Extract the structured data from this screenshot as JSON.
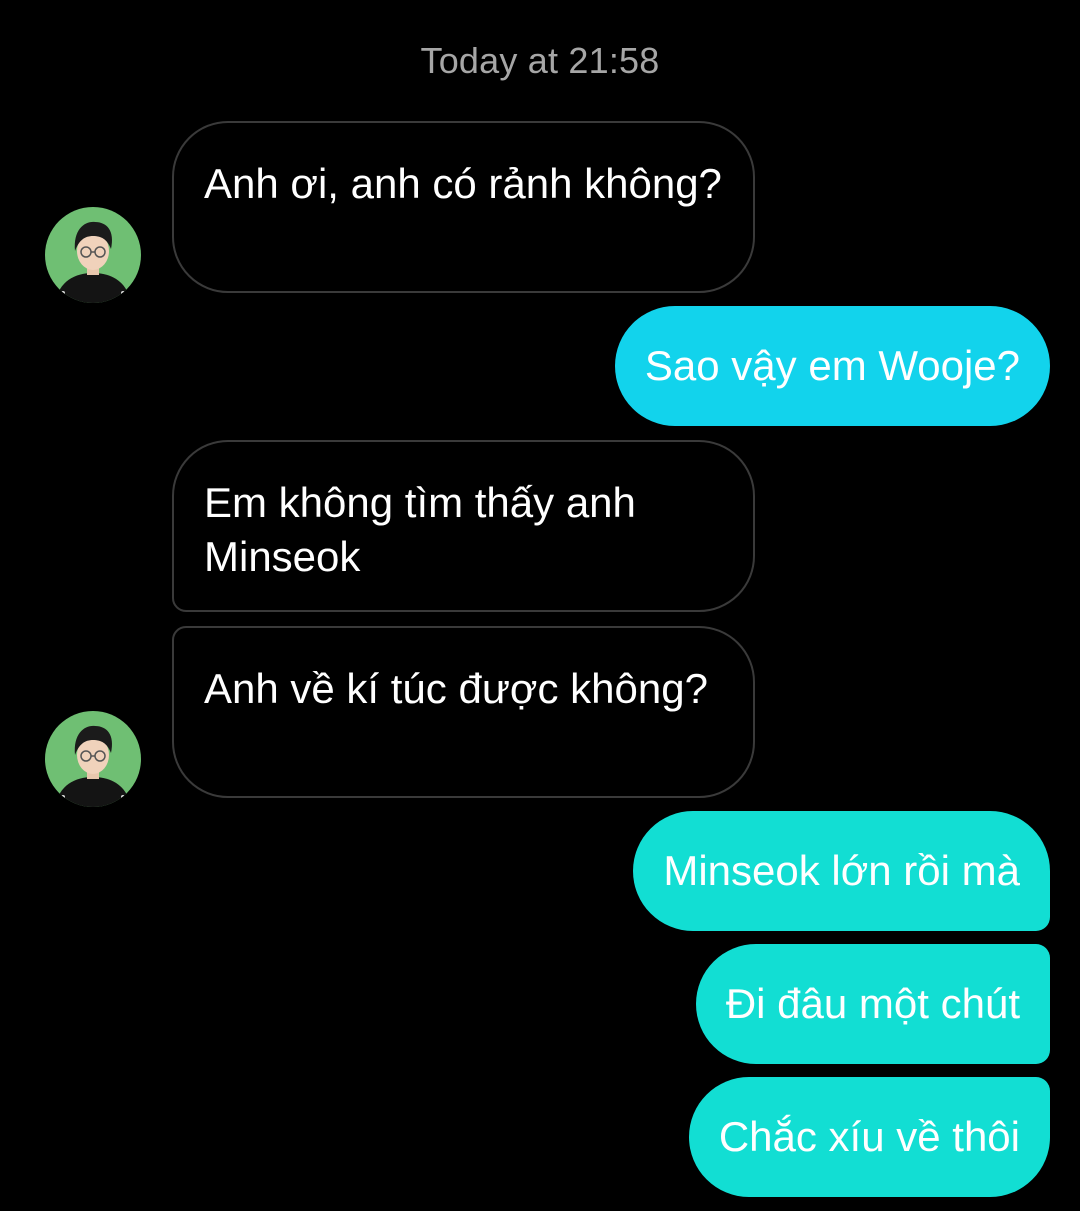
{
  "header": {
    "timestamp": "Today at 21:58"
  },
  "colors": {
    "background": "#000000",
    "incoming_border": "#3a3a3a",
    "outgoing_bubble_1": "#12d3ec",
    "outgoing_bubble_2": "#12ded3",
    "text": "#ffffff",
    "timestamp": "#a6a6a6"
  },
  "messages": [
    {
      "direction": "incoming",
      "text": "Anh ơi, anh có rảnh không?"
    },
    {
      "direction": "outgoing",
      "text": "Sao vậy em Wooje?"
    },
    {
      "direction": "incoming",
      "text": "Em không tìm thấy anh Minseok"
    },
    {
      "direction": "incoming",
      "text": "Anh về kí túc được không?"
    },
    {
      "direction": "outgoing",
      "text": "Minseok lớn rồi mà"
    },
    {
      "direction": "outgoing",
      "text": "Đi đâu một chút"
    },
    {
      "direction": "outgoing",
      "text": "Chắc xíu về thôi"
    }
  ],
  "avatar": {
    "icon": "user-avatar-icon"
  }
}
